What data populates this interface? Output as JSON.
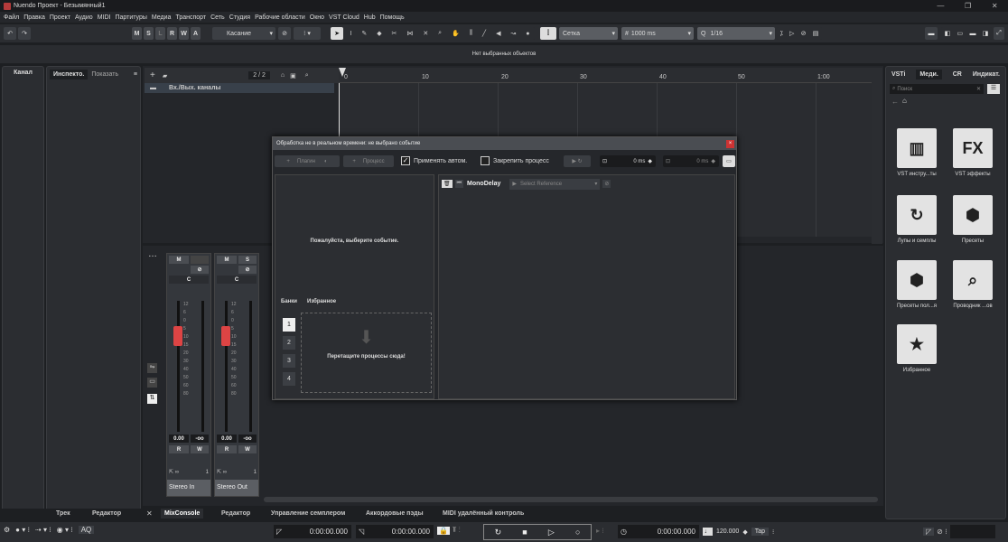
{
  "window": {
    "title": "Nuendo Проект - Безымянный1"
  },
  "menu": [
    "Файл",
    "Правка",
    "Проект",
    "Аудио",
    "MIDI",
    "Партитуры",
    "Медиа",
    "Транспорт",
    "Сеть",
    "Студия",
    "Рабочие области",
    "Окно",
    "VST Cloud",
    "Hub",
    "Помощь"
  ],
  "toolbar": {
    "modes": [
      "M",
      "S",
      "L",
      "R",
      "W",
      "A"
    ],
    "automation_mode": "Касание",
    "snap_label": "Сетка",
    "grid_value": "1000 ms",
    "quantize_value": "1/16"
  },
  "info_line": {
    "text": "Нет выбранных объектов"
  },
  "left_panels": {
    "channel_tab": "Канал",
    "inspector_tab": "Инспекто.",
    "show_tab": "Показать"
  },
  "project": {
    "track_counter": "2 / 2",
    "track_name": "Вх./Вых. каналы",
    "ruler_ticks": [
      "0",
      "10",
      "20",
      "30",
      "40",
      "50",
      "1:00"
    ]
  },
  "mixer": {
    "strips": [
      {
        "name": "Stereo In",
        "mute": "M",
        "solo": "S",
        "pan": "C",
        "vol": "0.00",
        "peak": "-oo",
        "read": "R",
        "write": "W",
        "routing": "1"
      },
      {
        "name": "Stereo Out",
        "mute": "M",
        "solo": "S",
        "pan": "C",
        "vol": "0.00",
        "peak": "-oo",
        "read": "R",
        "write": "W",
        "routing": "1"
      }
    ],
    "scale": [
      "12",
      "6",
      "0",
      "5",
      "10",
      "15",
      "20",
      "30",
      "40",
      "50",
      "60",
      "80"
    ]
  },
  "dialog": {
    "title": "Обработка не в реальном времени: не выбрано событие",
    "plugin_button": "Плагин",
    "process_button": "Процесс",
    "apply_auto": "Применять автом.",
    "lock_process": "Закрепить процесс",
    "time1": "0 ms",
    "time2": "0 ms",
    "select_event": "Пожалуйста, выберите событие.",
    "banks_label": "Банки",
    "favorites_label": "Избранное",
    "banks": [
      "1",
      "2",
      "3",
      "4"
    ],
    "drop_text": "Перетащите процессы сюда!",
    "plugin_name": "MonoDelay",
    "reference_placeholder": "Select Reference"
  },
  "right_panel": {
    "tabs": [
      "VSTi",
      "Меди.",
      "CR",
      "Индикат."
    ],
    "search_placeholder": "Поиск",
    "items": [
      {
        "label": "VST инстру...ты",
        "icon": "piano-icon"
      },
      {
        "label": "VST эффекты",
        "icon": "fx-icon"
      },
      {
        "label": "Лупы и семплы",
        "icon": "loop-icon"
      },
      {
        "label": "Пресеты",
        "icon": "presets-icon"
      },
      {
        "label": "Пресеты пол...я",
        "icon": "user-presets-icon"
      },
      {
        "label": "Проводник ...ов",
        "icon": "browser-icon"
      },
      {
        "label": "Избранное",
        "icon": "star-icon"
      }
    ]
  },
  "bottom_tabs": {
    "left": [
      "Трек",
      "Редактор"
    ],
    "main": [
      "MixConsole",
      "Редактор",
      "Управление семплером",
      "Аккордовые пэды",
      "MIDI удалённый контроль"
    ]
  },
  "transport": {
    "left_locator": "0:00:00.000",
    "right_locator": "0:00:00.000",
    "position": "0:00:00.000",
    "tempo": "120.000",
    "tap": "Tap",
    "aq": "AQ"
  }
}
